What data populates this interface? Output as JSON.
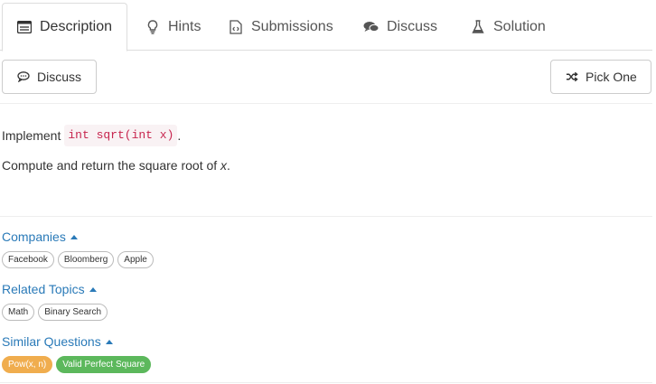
{
  "tabs": [
    {
      "label": "Description",
      "icon": "description-icon"
    },
    {
      "label": "Hints",
      "icon": "lightbulb-icon"
    },
    {
      "label": "Submissions",
      "icon": "code-file-icon"
    },
    {
      "label": "Discuss",
      "icon": "comments-icon"
    },
    {
      "label": "Solution",
      "icon": "flask-icon"
    }
  ],
  "toolbar": {
    "discuss_label": "Discuss",
    "pick_one_label": "Pick One"
  },
  "description": {
    "line1_prefix": "Implement",
    "code": "int sqrt(int x)",
    "line1_suffix": ".",
    "line2_text": "Compute and return the square root of ",
    "line2_var": "x",
    "line2_end": "."
  },
  "companies": {
    "title": "Companies",
    "tags": [
      "Facebook",
      "Bloomberg",
      "Apple"
    ]
  },
  "related_topics": {
    "title": "Related Topics",
    "tags": [
      "Math",
      "Binary Search"
    ]
  },
  "similar_questions": {
    "title": "Similar Questions",
    "items": [
      {
        "label": "Pow(x, n)",
        "difficulty_color": "#f0ad4e"
      },
      {
        "label": "Valid Perfect Square",
        "difficulty_color": "#5cb85c"
      }
    ]
  }
}
